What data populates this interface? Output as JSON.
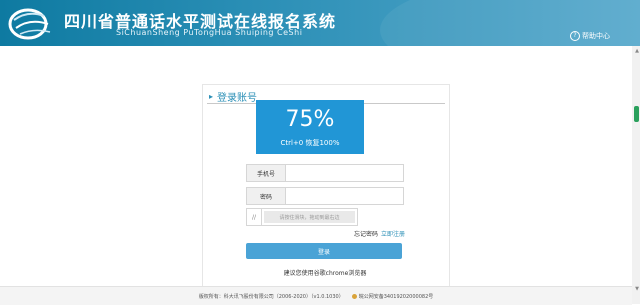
{
  "header": {
    "title_cn": "四川省普通话水平测试在线报名系统",
    "title_en": "SiChuanSheng PuTongHua Shuiping CeShi",
    "help": "帮助中心"
  },
  "panel": {
    "title": "登录账号"
  },
  "zoom": {
    "percent": "75%",
    "hint": "Ctrl+0 恢复100%"
  },
  "form": {
    "phone_label": "手机号",
    "phone_value": "",
    "password_label": "密码",
    "password_value": "",
    "captcha_text": "请按住滑块，拖动到最右边",
    "forgot": "忘记密码",
    "register": "立即注册",
    "login": "登录"
  },
  "tip": "建议您使用谷歌chrome浏览器",
  "footer": {
    "copyright": "版权所有：科大讯飞股份有限公司（2006-2020）（v1.0.1030）",
    "police": "皖公网安备34019202000082号"
  },
  "colors": {
    "header": "#2b8fb6",
    "zoom_popup": "#2196d6",
    "button": "#4aa3d6"
  }
}
